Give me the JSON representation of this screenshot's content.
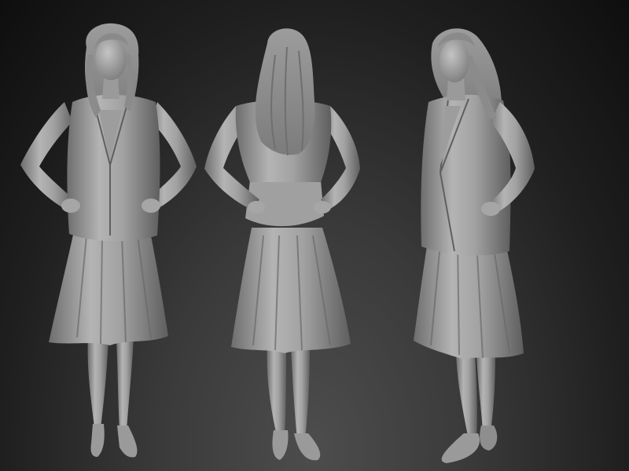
{
  "scene": {
    "subject": "3d-sculpt-turnaround",
    "views": [
      "front",
      "back",
      "three-quarter"
    ],
    "colors": {
      "background_top": "#0e0e0e",
      "background_bottom": "#4d4d4d",
      "clay_light": "#b9b9b9",
      "clay_mid": "#8e8e8e",
      "clay_dark": "#555555"
    }
  }
}
